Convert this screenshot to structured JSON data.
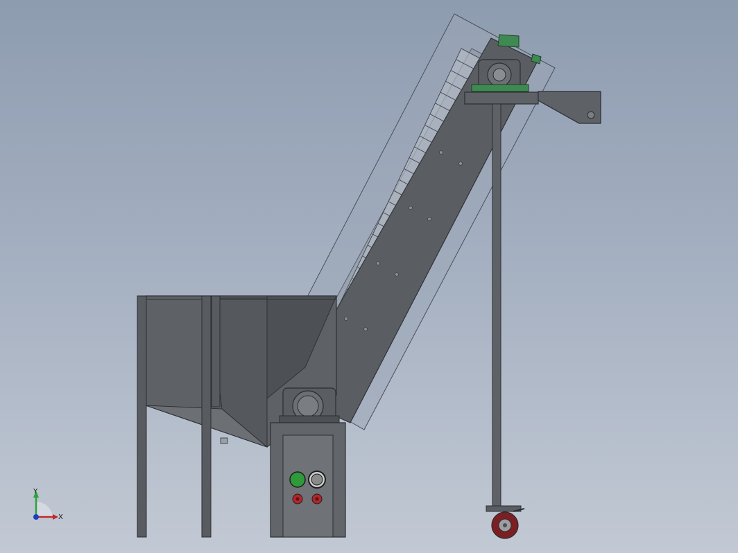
{
  "view": {
    "background_top": "#8e9cb0",
    "background_bottom": "#c2c9d4",
    "model": "inclined-belt-conveyor-with-hopper"
  },
  "triad": {
    "y_label": "Y",
    "x_label": "X",
    "colors": {
      "x": "#c0262d",
      "y": "#2aa33b",
      "z": "#1f3fbf"
    }
  },
  "control_panel": {
    "start_button_color": "#2f9a3a",
    "stop_button_color": "#8a8a8a",
    "indicator_color": "#b3262b"
  },
  "colors": {
    "metal_dark": "#55585d",
    "metal_mid": "#6a6d72",
    "cover_glass": "#9aa6b6",
    "bearing_green": "#3e8a52",
    "wheel": "#7b1f22"
  }
}
